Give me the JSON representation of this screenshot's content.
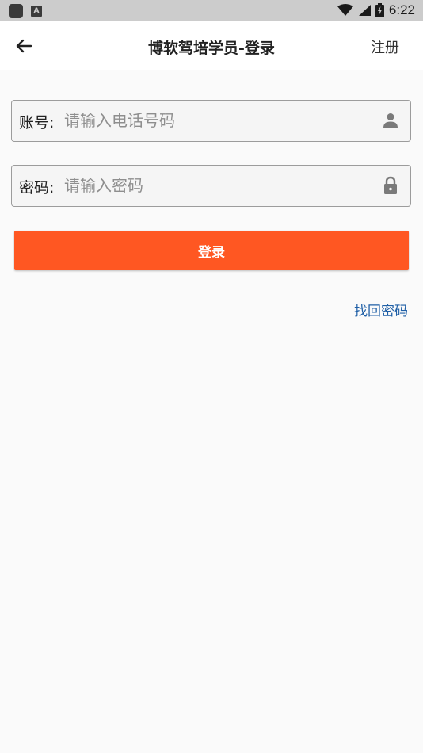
{
  "status_bar": {
    "time": "6:22",
    "icons": [
      "app-square-icon",
      "a-badge-icon",
      "wifi-icon",
      "signal-icon",
      "battery-icon"
    ]
  },
  "header": {
    "title": "博软驾培学员-登录",
    "back_icon": "arrow-left-icon",
    "register_label": "注册"
  },
  "form": {
    "account": {
      "label": "账号:",
      "placeholder": "请输入电话号码",
      "value": "",
      "icon": "person-icon"
    },
    "password": {
      "label": "密码:",
      "placeholder": "请输入密码",
      "value": "",
      "icon": "lock-icon"
    },
    "login_label": "登录",
    "forgot_label": "找回密码"
  },
  "colors": {
    "accent": "#ff5722",
    "link": "#1f5fa6",
    "status_bar": "#cccccc",
    "background": "#fafafa"
  }
}
